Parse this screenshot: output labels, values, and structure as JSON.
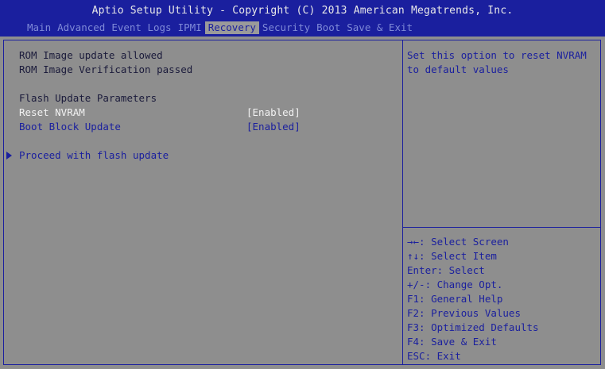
{
  "header": {
    "title": "Aptio Setup Utility - Copyright (C) 2013 American Megatrends, Inc.",
    "menu": [
      {
        "label": "Main"
      },
      {
        "label": "Advanced"
      },
      {
        "label": "Event Logs"
      },
      {
        "label": "IPMI"
      },
      {
        "label": "Recovery"
      },
      {
        "label": "Security"
      },
      {
        "label": "Boot"
      },
      {
        "label": "Save & Exit"
      }
    ],
    "active_tab": "Recovery"
  },
  "main": {
    "status1": "ROM Image update allowed",
    "status2": "ROM Image Verification passed",
    "section_title": "Flash Update Parameters",
    "options": [
      {
        "label": "Reset NVRAM",
        "value": "[Enabled]"
      },
      {
        "label": "Boot Block Update",
        "value": "[Enabled]"
      }
    ],
    "proceed_label": "Proceed with flash update"
  },
  "help": {
    "line1": "Set this option to reset NVRAM",
    "line2": "to default values"
  },
  "keys": [
    "→←: Select Screen",
    "↑↓: Select Item",
    "Enter: Select",
    "+/-: Change Opt.",
    "F1: General Help",
    "F2: Previous Values",
    "F3: Optimized Defaults",
    "F4: Save & Exit",
    "ESC: Exit"
  ],
  "colors": {
    "background": "#8e8e8e",
    "header": "#1a1f9e",
    "highlight_text": "#f2f2f2",
    "item_text": "#1a1f9e"
  }
}
